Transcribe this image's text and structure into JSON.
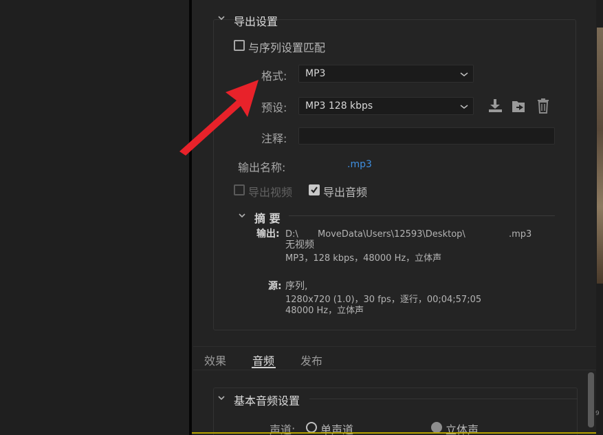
{
  "export": {
    "section_title": "导出设置",
    "match_sequence_label": "与序列设置匹配",
    "format_label": "格式:",
    "format_value": "MP3",
    "preset_label": "预设:",
    "preset_value": "MP3 128 kbps",
    "comment_label": "注释:",
    "comment_value": "",
    "output_name_label": "输出名称:",
    "output_name_value": ".mp3",
    "export_video_label": "导出视频",
    "export_video_checked": false,
    "export_audio_label": "导出音频",
    "export_audio_checked": true
  },
  "summary": {
    "title": "摘 要",
    "output_label": "输出:",
    "output_path_part1": "D:\\",
    "output_path_part2": "MoveData\\Users\\12593\\Desktop\\",
    "output_path_ext": ".mp3",
    "output_line2": "无视频",
    "output_line3": "MP3，128 kbps，48000 Hz，立体声",
    "source_label": "源:",
    "source_line1": "序列,",
    "source_line2": "1280x720 (1.0)，30 fps，逐行，00;04;57;05",
    "source_line3": "48000 Hz，立体声"
  },
  "tabs": [
    {
      "label": "效果",
      "active": false
    },
    {
      "label": "音频",
      "active": true
    },
    {
      "label": "发布",
      "active": false
    }
  ],
  "audio": {
    "section_title": "基本音频设置",
    "channel_label": "声道:",
    "mono_label": "单声道",
    "stereo_label": "立体声",
    "selected": "stereo"
  },
  "edge_mark": "9",
  "colors": {
    "link": "#3f8fe0",
    "arrow": "#e8222a",
    "background": "#232323"
  }
}
